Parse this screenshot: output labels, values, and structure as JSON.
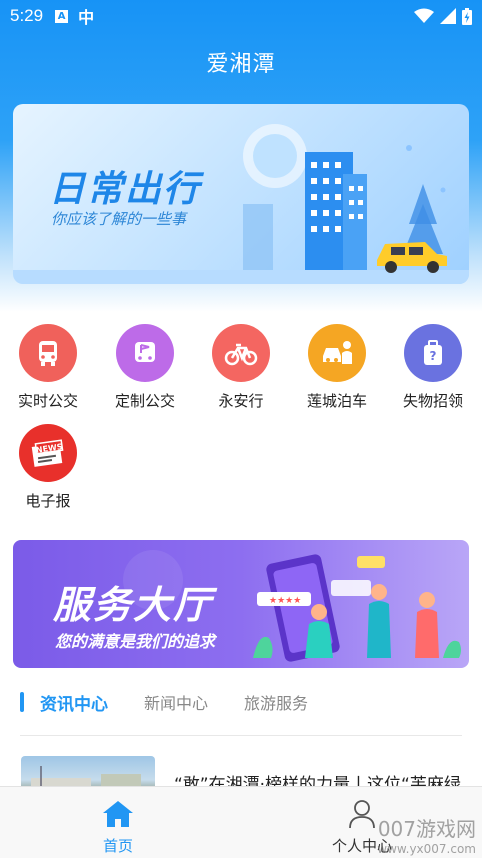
{
  "status_bar": {
    "time": "5:29",
    "app_icon_letter": "A",
    "app_icon_glyph": "中"
  },
  "app": {
    "title": "爱湘潭"
  },
  "banner_top": {
    "title": "日常出行",
    "subtitle": "你应该了解的一些事"
  },
  "services": [
    {
      "label": "实时公交",
      "icon": "bus-icon",
      "color": "#f0615b"
    },
    {
      "label": "定制公交",
      "icon": "custom-bus-icon",
      "color": "#bd6be8"
    },
    {
      "label": "永安行",
      "icon": "bicycle-icon",
      "color": "#f46661"
    },
    {
      "label": "莲城泊车",
      "icon": "parking-car-icon",
      "color": "#f5a623"
    },
    {
      "label": "失物招领",
      "icon": "luggage-icon",
      "color": "#6a72e0"
    },
    {
      "label": "电子报",
      "icon": "newspaper-icon",
      "color": "#e8302b",
      "badge": "NEWS"
    }
  ],
  "banner_service": {
    "title": "服务大厅",
    "subtitle": "您的满意是我们的追求"
  },
  "news_tabs": [
    {
      "label": "资讯中心",
      "active": true
    },
    {
      "label": "新闻中心",
      "active": false
    },
    {
      "label": "旅游服务",
      "active": false
    }
  ],
  "news_items": [
    {
      "title": "“敢”在湘潭·榜样的力量丨这位“芙麻绿"
    }
  ],
  "bottom_nav": [
    {
      "label": "首页",
      "icon": "home-icon",
      "active": true
    },
    {
      "label": "个人中心",
      "icon": "user-icon",
      "active": false
    }
  ],
  "watermark": {
    "line1": "007游戏网",
    "line2": "www.yx007.com"
  },
  "colors": {
    "primary": "#2196f3",
    "header": "#1793f6",
    "service_banner": "#7b5be8"
  }
}
